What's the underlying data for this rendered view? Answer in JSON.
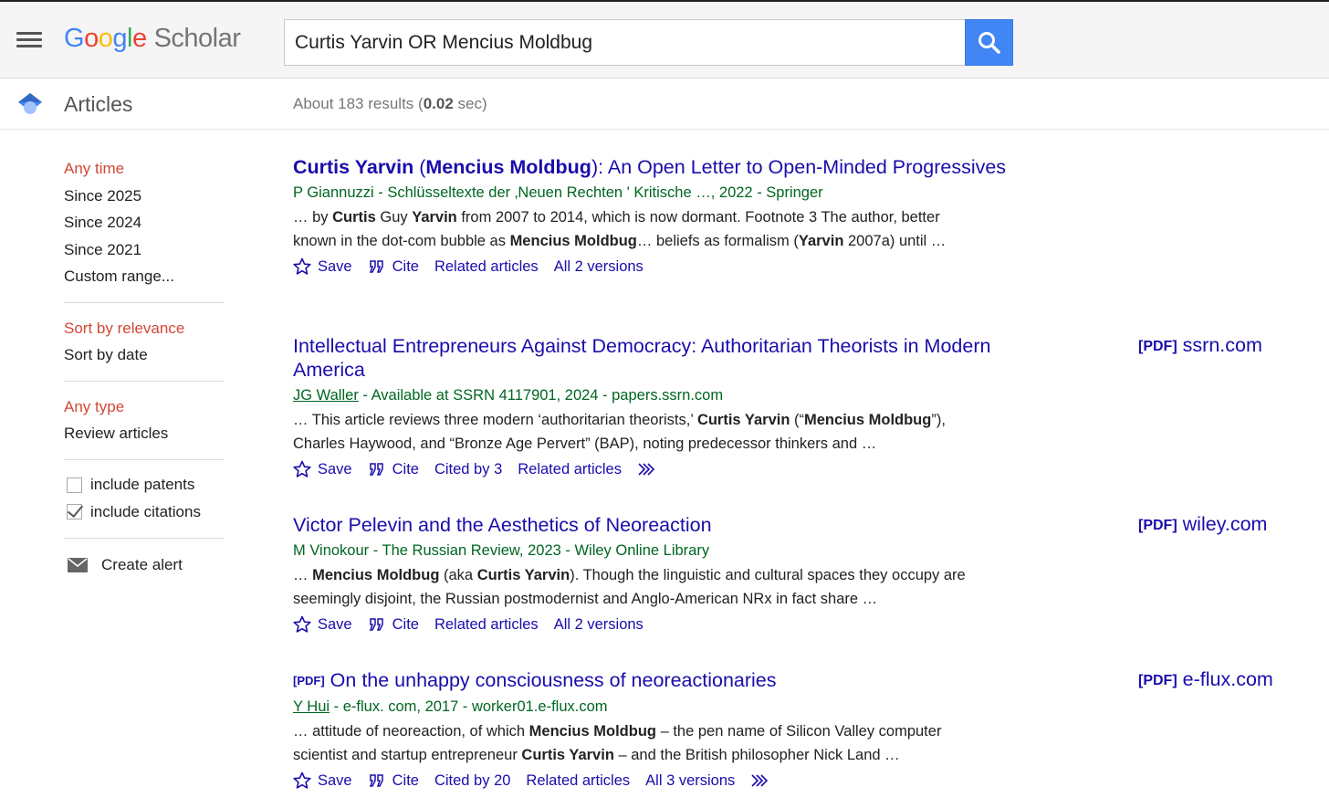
{
  "header": {
    "logo_google": [
      "G",
      "o",
      "o",
      "g",
      "l",
      "e"
    ],
    "logo_scholar": "Scholar",
    "search_value": "Curtis Yarvin OR Mencius Moldbug"
  },
  "subbar": {
    "section_label": "Articles",
    "stats_prefix": "About 183 results (",
    "stats_time": "0.02",
    "stats_suffix": " sec)"
  },
  "sidebar": {
    "time": [
      "Any time",
      "Since 2025",
      "Since 2024",
      "Since 2021",
      "Custom range..."
    ],
    "sort": [
      "Sort by relevance",
      "Sort by date"
    ],
    "type": [
      "Any type",
      "Review articles"
    ],
    "include_patents": "include patents",
    "include_citations": "include citations",
    "create_alert": "Create alert"
  },
  "results": [
    {
      "title_parts": [
        {
          "t": "Curtis Yarvin",
          "b": true
        },
        {
          "t": " (",
          "b": false
        },
        {
          "t": "Mencius Moldbug",
          "b": true
        },
        {
          "t": "): An Open Letter to Open-Minded Progressives",
          "b": false
        }
      ],
      "author": "P Giannuzzi",
      "meta": " - Schlüsseltexte der ‚Neuen Rechten ' Kritische …, 2022 - Springer",
      "snippet_parts": [
        {
          "t": "… by ",
          "b": false
        },
        {
          "t": "Curtis",
          "b": true
        },
        {
          "t": " Guy ",
          "b": false
        },
        {
          "t": "Yarvin",
          "b": true
        },
        {
          "t": " from 2007 to 2014, which is now dormant. Footnote 3 The author, better known in the dot-com bubble as ",
          "b": false
        },
        {
          "t": "Mencius Moldbug",
          "b": true
        },
        {
          "t": "… beliefs as formalism (",
          "b": false
        },
        {
          "t": "Yarvin",
          "b": true
        },
        {
          "t": " 2007a) until …",
          "b": false
        }
      ],
      "actions": [
        "Save",
        "Cite",
        "Related articles",
        "All 2 versions"
      ]
    },
    {
      "title_parts": [
        {
          "t": "Intellectual Entrepreneurs Against Democracy: Authoritarian Theorists in Modern America",
          "b": false
        }
      ],
      "author": "JG Waller",
      "meta": " - Available at SSRN 4117901, 2024 - papers.ssrn.com",
      "snippet_parts": [
        {
          "t": "… This article reviews three modern ‘authoritarian theorists,’ ",
          "b": false
        },
        {
          "t": "Curtis Yarvin",
          "b": true
        },
        {
          "t": " (“",
          "b": false
        },
        {
          "t": "Mencius Moldbug",
          "b": true
        },
        {
          "t": "”), Charles Haywood, and “Bronze Age Pervert” (BAP), noting predecessor thinkers and …",
          "b": false
        }
      ],
      "actions": [
        "Save",
        "Cite",
        "Cited by 3",
        "Related articles"
      ],
      "side_pdf": "[PDF]",
      "side_domain": "ssrn.com"
    },
    {
      "title_parts": [
        {
          "t": "Victor Pelevin and the Aesthetics of Neoreaction",
          "b": false
        }
      ],
      "author": "M Vinokour",
      "meta": " - The Russian Review, 2023 - Wiley Online Library",
      "snippet_parts": [
        {
          "t": "… ",
          "b": false
        },
        {
          "t": "Mencius Moldbug",
          "b": true
        },
        {
          "t": " (aka ",
          "b": false
        },
        {
          "t": "Curtis Yarvin",
          "b": true
        },
        {
          "t": "). Though the linguistic and cultural spaces they occupy are seemingly disjoint, the Russian postmodernist and Anglo-American NRx in fact share …",
          "b": false
        }
      ],
      "actions": [
        "Save",
        "Cite",
        "Related articles",
        "All 2 versions"
      ],
      "side_pdf": "[PDF]",
      "side_domain": "wiley.com"
    },
    {
      "title_pdf": "[PDF]",
      "title_parts": [
        {
          "t": "On the unhappy consciousness of neoreactionaries",
          "b": false
        }
      ],
      "author": "Y Hui",
      "meta": " - e-flux. com, 2017 - worker01.e-flux.com",
      "snippet_parts": [
        {
          "t": "… attitude of neoreaction, of which ",
          "b": false
        },
        {
          "t": "Mencius Moldbug",
          "b": true
        },
        {
          "t": " – the pen name of Silicon Valley computer scientist and startup entrepreneur ",
          "b": false
        },
        {
          "t": "Curtis Yarvin",
          "b": true
        },
        {
          "t": " – and the British philosopher Nick Land …",
          "b": false
        }
      ],
      "actions": [
        "Save",
        "Cite",
        "Cited by 20",
        "Related articles",
        "All 3 versions"
      ],
      "side_pdf": "[PDF]",
      "side_domain": "e-flux.com"
    }
  ],
  "colors": {
    "link": "#1a0dab",
    "green": "#006621",
    "active_red": "#d14836",
    "search_blue": "#4285f4"
  },
  "icons": [
    "menu-icon",
    "search-icon",
    "graduation-cap-icon",
    "envelope-icon",
    "star-icon",
    "quote-icon",
    "more-arrows-icon"
  ]
}
